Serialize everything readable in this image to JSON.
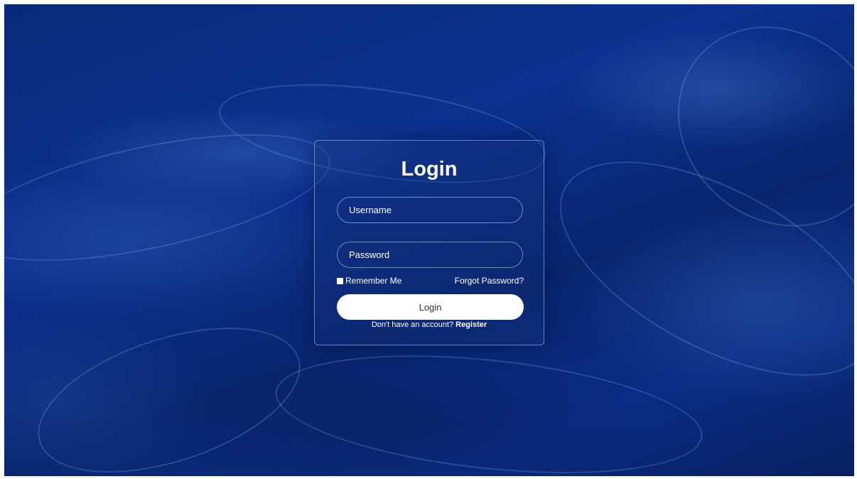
{
  "login": {
    "title": "Login",
    "username_placeholder": "Username",
    "password_placeholder": "Password",
    "remember_label": "Remember Me",
    "forgot_label": "Forgot Password?",
    "submit_label": "Login",
    "register_prompt": "Don't have an account?",
    "register_label": "Register"
  },
  "colors": {
    "background": "#0b2c84",
    "card_border": "#b4c8f0",
    "button": "#ffffff"
  }
}
